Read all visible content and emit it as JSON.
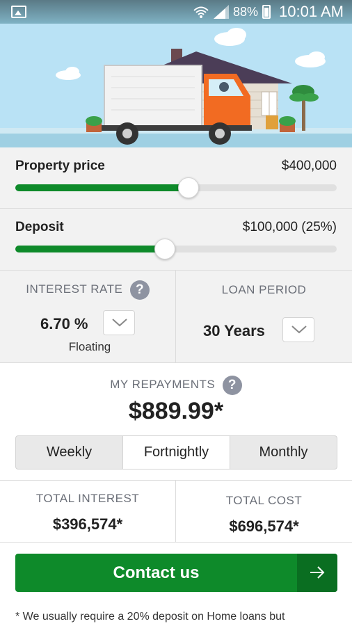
{
  "status_bar": {
    "battery": "88%",
    "time": "10:01 AM",
    "icons": [
      "gallery-icon",
      "wifi-icon",
      "signal-icon",
      "battery-icon"
    ]
  },
  "hero": {
    "illustration": "moving-truck-in-front-of-house"
  },
  "property_price": {
    "label": "Property price",
    "value": "$400,000",
    "slider_fraction": 0.538
  },
  "deposit": {
    "label": "Deposit",
    "value": "$100,000 (25%)",
    "slider_fraction": 0.465
  },
  "interest_rate": {
    "caption": "INTEREST RATE",
    "help": "?",
    "value": "6.70 %",
    "type": "Floating"
  },
  "loan_period": {
    "caption": "LOAN PERIOD",
    "value": "30 Years"
  },
  "repayments": {
    "caption": "MY REPAYMENTS",
    "help": "?",
    "amount": "$889.99*",
    "frequencies": [
      "Weekly",
      "Fortnightly",
      "Monthly"
    ],
    "selected": "Fortnightly"
  },
  "totals": {
    "interest_label": "TOTAL INTEREST",
    "interest_value": "$396,574*",
    "cost_label": "TOTAL COST",
    "cost_value": "$696,574*"
  },
  "contact": {
    "label": "Contact us",
    "icon": "arrow-right-icon"
  },
  "disclaimer": "* We usually require a 20% deposit on Home loans but",
  "colors": {
    "accent_green": "#0e8a2a",
    "accent_green_dark": "#0a6e21",
    "caption_gray": "#6b6f78",
    "help_icon_gray": "#8e93a1",
    "sky": "#b9e2f5",
    "truck_orange": "#f26b22"
  }
}
